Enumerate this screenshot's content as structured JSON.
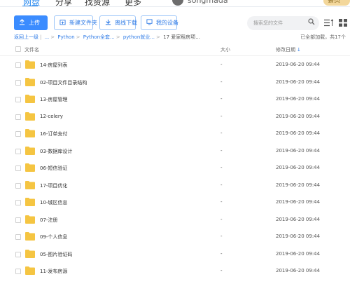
{
  "topnav": {
    "items": [
      "网盘",
      "分享",
      "找资源",
      "更多"
    ],
    "username": "songmada",
    "vip": "会员"
  },
  "toolbar": {
    "upload_label": "上传",
    "new_folder_label": "新建文件夹",
    "offline_download_label": "离线下载",
    "my_device_label": "我的设备",
    "search_placeholder": "搜索您的文件"
  },
  "breadcrumb": {
    "back": "返回上一级",
    "items": [
      "...",
      "Python",
      "Python全套...",
      "python就业...",
      "17 爱家租房项..."
    ]
  },
  "status": "已全部加载，共17个",
  "table": {
    "columns": {
      "name": "文件名",
      "size": "大小",
      "date": "修改日期"
    },
    "rows": [
      {
        "name": "14-房屋列表",
        "size": "-",
        "date": "2019-06-20 09:44"
      },
      {
        "name": "02-项目文件目录结构",
        "size": "-",
        "date": "2019-06-20 09:44"
      },
      {
        "name": "13-房屋管理",
        "size": "-",
        "date": "2019-06-20 09:44"
      },
      {
        "name": "12-celery",
        "size": "-",
        "date": "2019-06-20 09:44"
      },
      {
        "name": "16-订单支付",
        "size": "-",
        "date": "2019-06-20 09:44"
      },
      {
        "name": "03-数据库设计",
        "size": "-",
        "date": "2019-06-20 09:44"
      },
      {
        "name": "06-短信验证",
        "size": "-",
        "date": "2019-06-20 09:44"
      },
      {
        "name": "17-项目优化",
        "size": "-",
        "date": "2019-06-20 09:44"
      },
      {
        "name": "10-城区信息",
        "size": "-",
        "date": "2019-06-20 09:44"
      },
      {
        "name": "07-注册",
        "size": "-",
        "date": "2019-06-20 09:44"
      },
      {
        "name": "09-个人信息",
        "size": "-",
        "date": "2019-06-20 09:44"
      },
      {
        "name": "05-图片验证码",
        "size": "-",
        "date": "2019-06-20 09:44"
      },
      {
        "name": "11-发布房源",
        "size": "-",
        "date": "2019-06-20 09:44"
      }
    ]
  },
  "colors": {
    "accent": "#3b8cff",
    "folder": "#f5c542"
  }
}
